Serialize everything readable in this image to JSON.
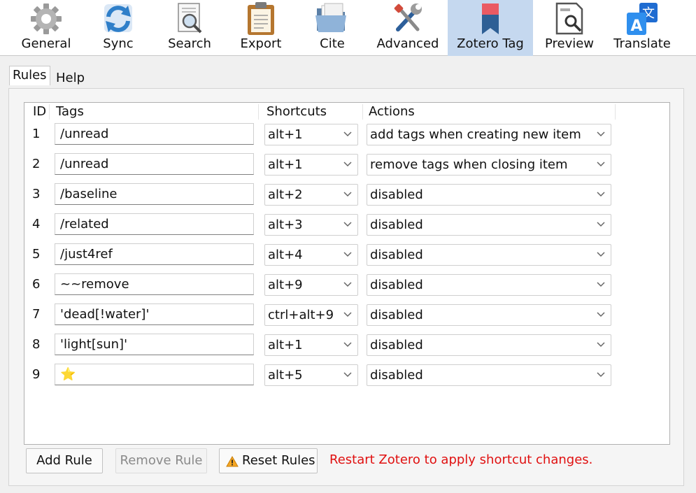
{
  "toolbar": {
    "items": [
      {
        "label": "General",
        "icon": "gear-icon"
      },
      {
        "label": "Sync",
        "icon": "sync-icon"
      },
      {
        "label": "Search",
        "icon": "search-icon"
      },
      {
        "label": "Export",
        "icon": "clipboard-icon"
      },
      {
        "label": "Cite",
        "icon": "folder-icon"
      },
      {
        "label": "Advanced",
        "icon": "tools-icon"
      },
      {
        "label": "Zotero Tag",
        "icon": "bookmark-icon",
        "selected": true
      },
      {
        "label": "Preview",
        "icon": "preview-icon"
      },
      {
        "label": "Translate",
        "icon": "translate-icon"
      }
    ]
  },
  "tabs": [
    {
      "label": "Rules",
      "active": true
    },
    {
      "label": "Help",
      "active": false
    }
  ],
  "table": {
    "headers": {
      "id": "ID",
      "tags": "Tags",
      "shortcuts": "Shortcuts",
      "actions": "Actions"
    },
    "rows": [
      {
        "id": "1",
        "tag": "/unread",
        "shortcut": "alt+1",
        "action": "add tags when creating new item"
      },
      {
        "id": "2",
        "tag": "/unread",
        "shortcut": "alt+1",
        "action": "remove tags when closing item"
      },
      {
        "id": "3",
        "tag": "/baseline",
        "shortcut": "alt+2",
        "action": "disabled"
      },
      {
        "id": "4",
        "tag": "/related",
        "shortcut": "alt+3",
        "action": "disabled"
      },
      {
        "id": "5",
        "tag": "/just4ref",
        "shortcut": "alt+4",
        "action": "disabled"
      },
      {
        "id": "6",
        "tag": "~~remove",
        "shortcut": "alt+9",
        "action": "disabled"
      },
      {
        "id": "7",
        "tag": "'dead[!water]'",
        "shortcut": "ctrl+alt+9",
        "action": "disabled"
      },
      {
        "id": "8",
        "tag": "'light[sun]'",
        "shortcut": "alt+1",
        "action": "disabled"
      },
      {
        "id": "9",
        "tag": "⭐",
        "shortcut": "alt+5",
        "action": "disabled"
      }
    ]
  },
  "buttons": {
    "add": "Add Rule",
    "remove": "Remove Rule",
    "reset": "Reset Rules"
  },
  "status_message": "Restart Zotero to apply shortcut changes.",
  "colors": {
    "selected_tab_bg": "#c5d8ef",
    "warning_text": "#e01010"
  }
}
